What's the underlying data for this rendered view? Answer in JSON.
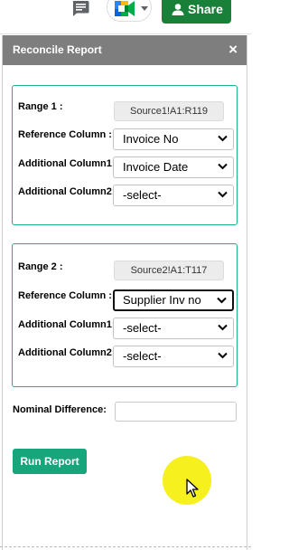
{
  "toolbar": {
    "share_label": "Share",
    "icons": [
      "chat-icon",
      "google-meet-icon",
      "person-icon"
    ]
  },
  "panel": {
    "title": "Reconcile Report",
    "close_symbol": "×"
  },
  "range1": {
    "range_label": "Range 1 :",
    "range_value": "Source1!A1:R119",
    "ref_label": "Reference Column :",
    "ref_value": "Invoice No",
    "add1_label": "Additional Column1:",
    "add1_value": "Invoice Date",
    "add2_label": "Additional Column2:",
    "add2_value": "-select-"
  },
  "range2": {
    "range_label": "Range 2 :",
    "range_value": "Source2!A1:T117",
    "ref_label": "Reference Column :",
    "ref_value": "Supplier Inv no",
    "add1_label": "Additional Column1:",
    "add1_value": "-select-",
    "add2_label": "Additional Column2:",
    "add2_value": "-select-"
  },
  "nominal": {
    "label": "Nominal Difference:",
    "value": ""
  },
  "run_label": "Run Report",
  "colors": {
    "accent_green": "#17a57c",
    "box_border": "#1db08b",
    "share_green": "#188038",
    "header_gray": "#7e7e7e",
    "cursor_highlight": "#f7f01f"
  }
}
